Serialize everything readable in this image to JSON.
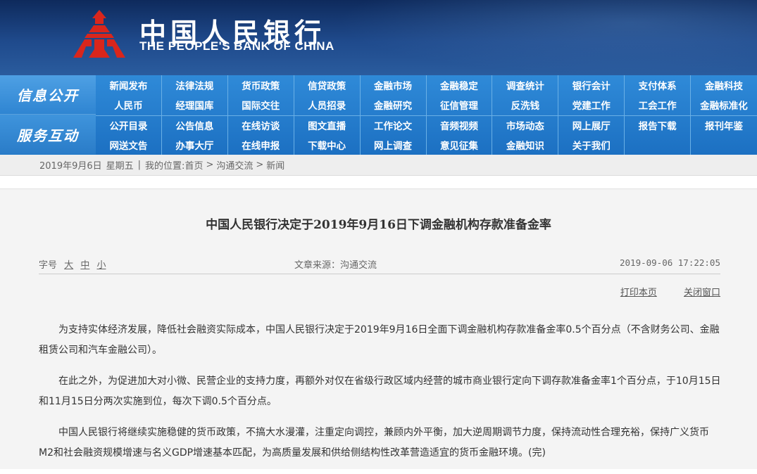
{
  "header": {
    "logo_cn": "中国人民银行",
    "logo_en": "THE PEOPLE'S BANK OF CHINA",
    "colors": {
      "header_bg": "#1f4a8c",
      "logo_red": "#d9261c",
      "nav_blue": "#1d78c8"
    }
  },
  "nav": {
    "section1": "信息公开",
    "section2": "服务互动",
    "rows": [
      [
        "新闻发布",
        "法律法规",
        "货币政策",
        "信贷政策",
        "金融市场",
        "金融稳定",
        "调查统计",
        "银行会计",
        "支付体系",
        "金融科技"
      ],
      [
        "人民币",
        "经理国库",
        "国际交往",
        "人员招录",
        "金融研究",
        "征信管理",
        "反洗钱",
        "党建工作",
        "工会工作",
        "金融标准化"
      ],
      [
        "公开目录",
        "公告信息",
        "在线访谈",
        "图文直播",
        "工作论文",
        "音频视频",
        "市场动态",
        "网上展厅",
        "报告下载",
        "报刊年鉴"
      ],
      [
        "网送文告",
        "办事大厅",
        "在线申报",
        "下载中心",
        "网上调查",
        "意见征集",
        "金融知识",
        "关于我们",
        "",
        ""
      ]
    ]
  },
  "breadcrumb": {
    "date": "2019年9月6日",
    "weekday": "星期五",
    "sep": "|",
    "location_label": "我的位置:",
    "home": "首页",
    "level1": "沟通交流",
    "level2": "新闻",
    "arrow": ">"
  },
  "article": {
    "title": "中国人民银行决定于2019年9月16日下调金融机构存款准备金率",
    "font_label": "字号",
    "font_large": "大",
    "font_medium": "中",
    "font_small": "小",
    "source": "文章来源：沟通交流",
    "datetime": "2019-09-06 17:22:05",
    "print": "打印本页",
    "close": "关闭窗口",
    "paragraphs": [
      "为支持实体经济发展，降低社会融资实际成本，中国人民银行决定于2019年9月16日全面下调金融机构存款准备金率0.5个百分点（不含财务公司、金融租赁公司和汽车金融公司）。",
      "在此之外，为促进加大对小微、民营企业的支持力度，再额外对仅在省级行政区域内经营的城市商业银行定向下调存款准备金率1个百分点，于10月15日和11月15日分两次实施到位，每次下调0.5个百分点。",
      "中国人民银行将继续实施稳健的货币政策，不搞大水漫灌，注重定向调控，兼顾内外平衡，加大逆周期调节力度，保持流动性合理充裕，保持广义货币M2和社会融资规模增速与名义GDP增速基本匹配，为高质量发展和供给侧结构性改革营造适宜的货币金融环境。(完)"
    ]
  }
}
